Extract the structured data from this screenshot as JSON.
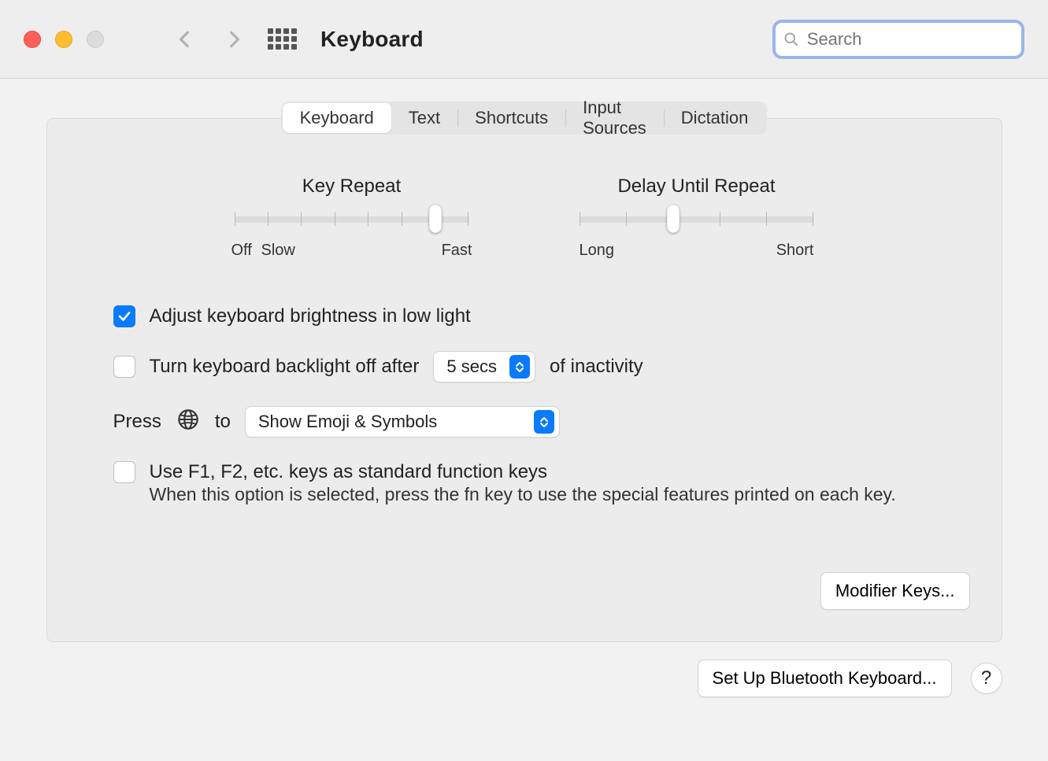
{
  "header": {
    "title": "Keyboard",
    "search_placeholder": "Search"
  },
  "tabs": [
    "Keyboard",
    "Text",
    "Shortcuts",
    "Input Sources",
    "Dictation"
  ],
  "active_tab": 0,
  "sliders": {
    "key_repeat": {
      "label": "Key Repeat",
      "ticks": 8,
      "value_index": 6,
      "labels": {
        "off": "Off",
        "slow": "Slow",
        "fast": "Fast"
      }
    },
    "delay_until_repeat": {
      "label": "Delay Until Repeat",
      "ticks": 6,
      "value_index": 2,
      "labels": {
        "long": "Long",
        "short": "Short"
      }
    }
  },
  "options": {
    "adjust_brightness": {
      "checked": true,
      "label": "Adjust keyboard brightness in low light"
    },
    "backlight_off": {
      "checked": false,
      "label_before": "Turn keyboard backlight off after",
      "select_value": "5 secs",
      "label_after": "of inactivity"
    },
    "globe_row": {
      "prefix": "Press",
      "mid": "to",
      "select_value": "Show Emoji & Symbols"
    },
    "fn_keys": {
      "checked": false,
      "label": "Use F1, F2, etc. keys as standard function keys",
      "hint": "When this option is selected, press the fn key to use the special features printed on each key."
    }
  },
  "buttons": {
    "modifier_keys": "Modifier Keys...",
    "bluetooth": "Set Up Bluetooth Keyboard...",
    "help": "?"
  }
}
